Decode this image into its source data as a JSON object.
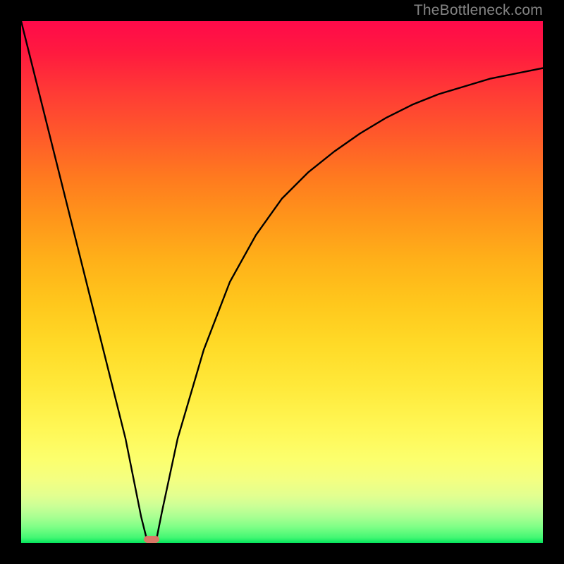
{
  "watermark": "TheBottleneck.com",
  "colors": {
    "frame": "#000000",
    "curve": "#000000",
    "marker": "#d97766",
    "watermark": "#848484"
  },
  "chart_data": {
    "type": "line",
    "title": "",
    "xlabel": "",
    "ylabel": "",
    "xlim": [
      0,
      100
    ],
    "ylim": [
      0,
      100
    ],
    "grid": false,
    "series": [
      {
        "name": "bottleneck-curve",
        "x": [
          0,
          5,
          10,
          15,
          20,
          23,
          24,
          25,
          26,
          27,
          30,
          35,
          40,
          45,
          50,
          55,
          60,
          65,
          70,
          75,
          80,
          85,
          90,
          95,
          100
        ],
        "y": [
          100,
          80,
          60,
          40,
          20,
          5,
          1,
          0,
          1,
          6,
          20,
          37,
          50,
          59,
          66,
          71,
          75,
          78.5,
          81.5,
          84,
          86,
          87.5,
          89,
          90,
          91
        ]
      }
    ],
    "annotations": [
      {
        "name": "minimum-marker",
        "x": 25,
        "y": 0
      }
    ],
    "background": {
      "type": "vertical-gradient",
      "description": "red (top) through orange/yellow to green (bottom)"
    }
  }
}
